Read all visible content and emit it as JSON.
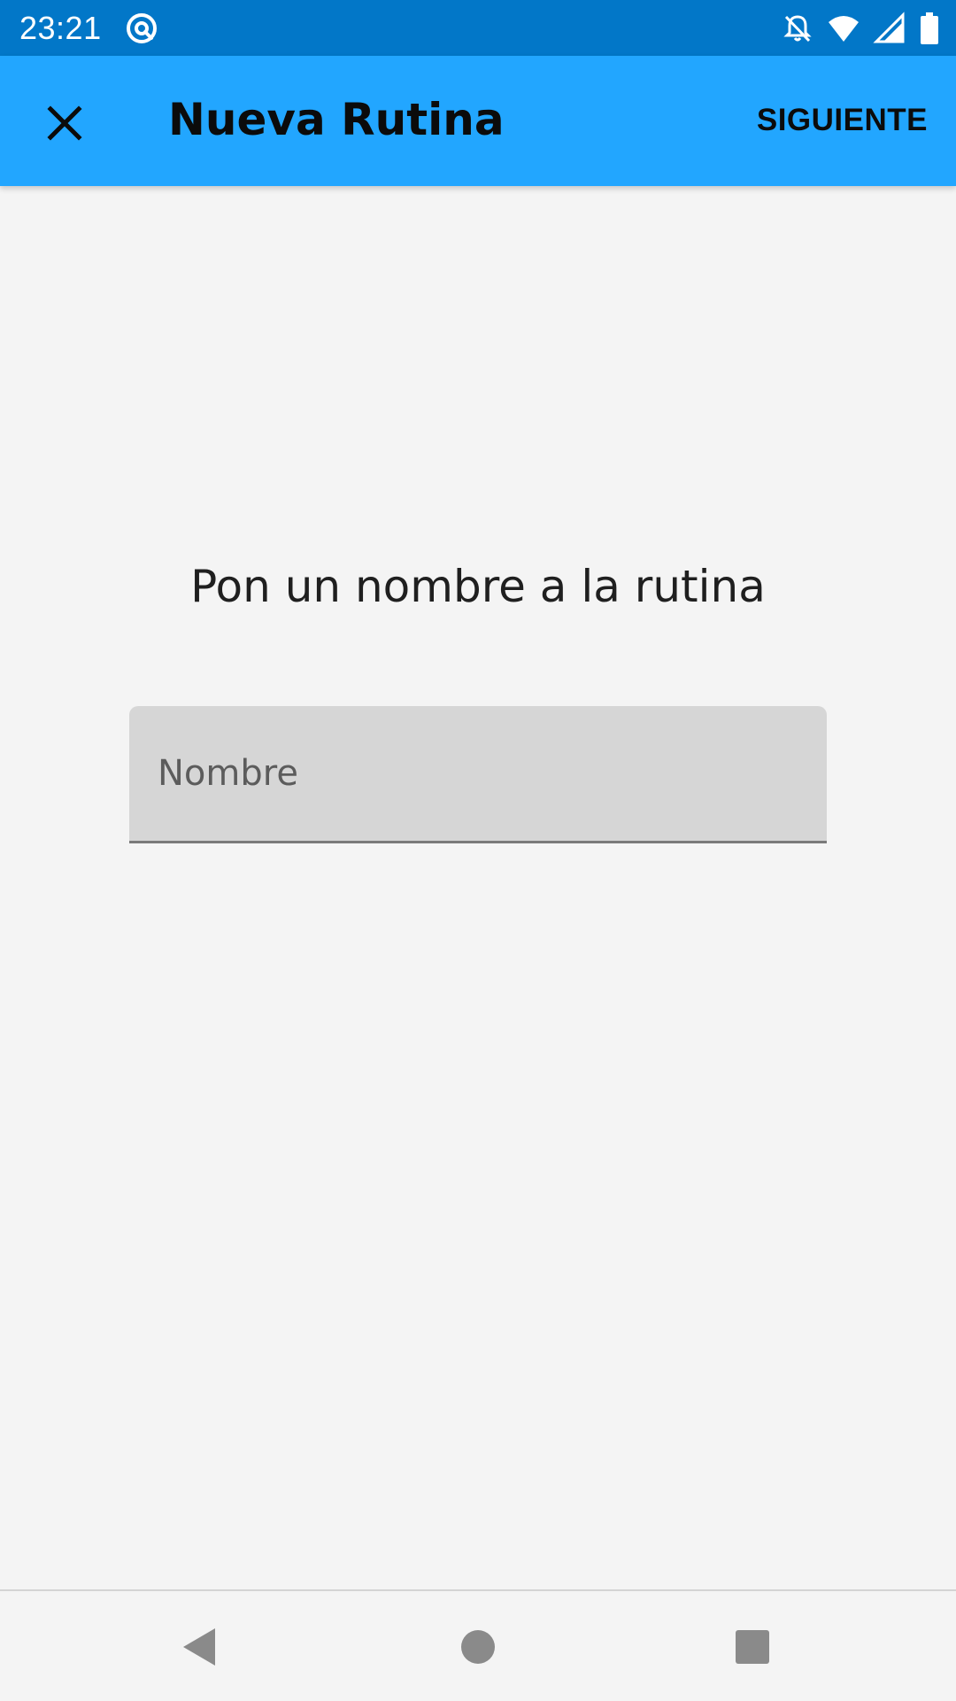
{
  "status_bar": {
    "time": "23:21",
    "left_icon": "at-sign-icon",
    "right_icons": [
      "bell-off-icon",
      "wifi-icon",
      "signal-icon",
      "battery-icon"
    ]
  },
  "app_bar": {
    "title": "Nueva Rutina",
    "close_icon": "close-icon",
    "next_label": "SIGUIENTE"
  },
  "content": {
    "prompt": "Pon un nombre a la rutina",
    "name_input": {
      "placeholder": "Nombre",
      "value": ""
    }
  },
  "nav_bar": {
    "icons": [
      "back-triangle-icon",
      "home-circle-icon",
      "recents-square-icon"
    ]
  },
  "colors": {
    "status_bar": "#0277c8",
    "app_bar": "#22a6ff",
    "background": "#f4f4f4",
    "input_fill": "#d6d6d6"
  }
}
